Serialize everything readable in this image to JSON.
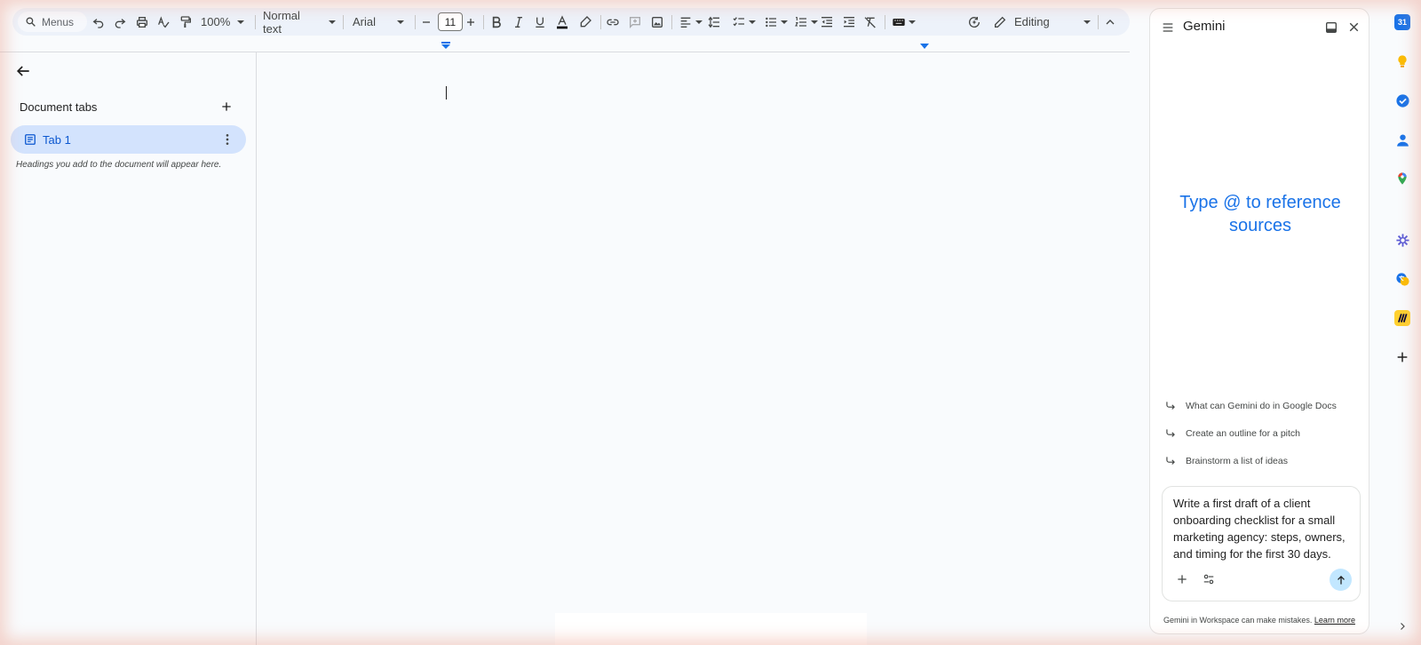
{
  "toolbar": {
    "search_menus_label": "Menus",
    "zoom_value": "100%",
    "style_value": "Normal text",
    "font_value": "Arial",
    "font_size_value": "11",
    "mode_label": "Editing"
  },
  "sidebar": {
    "section_title": "Document tabs",
    "tabs": [
      {
        "label": "Tab 1"
      }
    ],
    "headings_hint": "Headings you add to the document will appear here."
  },
  "gemini": {
    "title": "Gemini",
    "hero_line1": "Type @ to reference",
    "hero_line2": "sources",
    "suggestions": [
      {
        "label": "What can Gemini do in Google Docs"
      },
      {
        "label": "Create an outline for a pitch"
      },
      {
        "label": "Brainstorm a list of ideas"
      }
    ],
    "prompt_value": "Write a first draft of a client onboarding checklist for a small marketing agency: steps, owners, and timing for the first 30 days.",
    "disclaimer_text": "Gemini in Workspace can make mistakes.",
    "learn_more_label": "Learn more"
  },
  "right_rail": {
    "apps": [
      "calendar-icon",
      "keep-icon",
      "tasks-icon",
      "contacts-icon",
      "maps-icon",
      "app-addon-icon",
      "translate-addon-icon",
      "miro-addon-icon",
      "get-addons-icon",
      "expand-panel-icon"
    ],
    "calendar_day": "31",
    "colors": {
      "calendar": "#1a73e8",
      "keep": "#fbbc04",
      "tasks": "#1a73e8",
      "contacts": "#1a73e8",
      "addon_purple": "#5b5bd6",
      "miro": "#ffd02f"
    }
  },
  "colors": {
    "accent": "#1a73e8",
    "tab_active_bg": "#d3e3fd",
    "toolbar_bg": "#edf2fa",
    "send_button_bg": "#c2e7ff"
  }
}
